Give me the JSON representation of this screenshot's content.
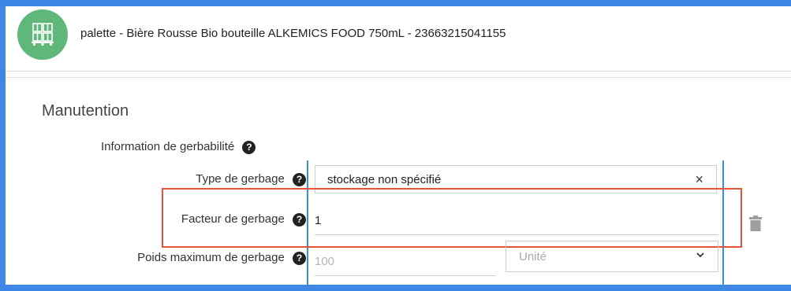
{
  "header": {
    "title": "palette - Bière Rousse Bio bouteille ALKEMICS FOOD 750mL - 23663215041155",
    "avatar_icon": "pallet-icon",
    "avatar_color": "#5fb87a"
  },
  "section": {
    "title": "Manutention",
    "group_label": "Information de gerbabilité"
  },
  "help_glyph": "?",
  "fields": {
    "type_gerbage": {
      "label": "Type de gerbage",
      "value": "stockage non spécifié",
      "clear_glyph": "×"
    },
    "facteur_gerbage": {
      "label": "Facteur de gerbage",
      "value": "1"
    },
    "poids_max": {
      "label": "Poids maximum de gerbage",
      "placeholder": "100",
      "unit_placeholder": "Unité"
    }
  },
  "colors": {
    "background": "#3f87e6",
    "highlight_border": "#e2553b",
    "accent_line": "#3a8fd0"
  },
  "icons": {
    "help": "question-circle-icon",
    "clear": "close-icon",
    "delete": "trash-icon",
    "dropdown": "chevron-down-icon"
  }
}
